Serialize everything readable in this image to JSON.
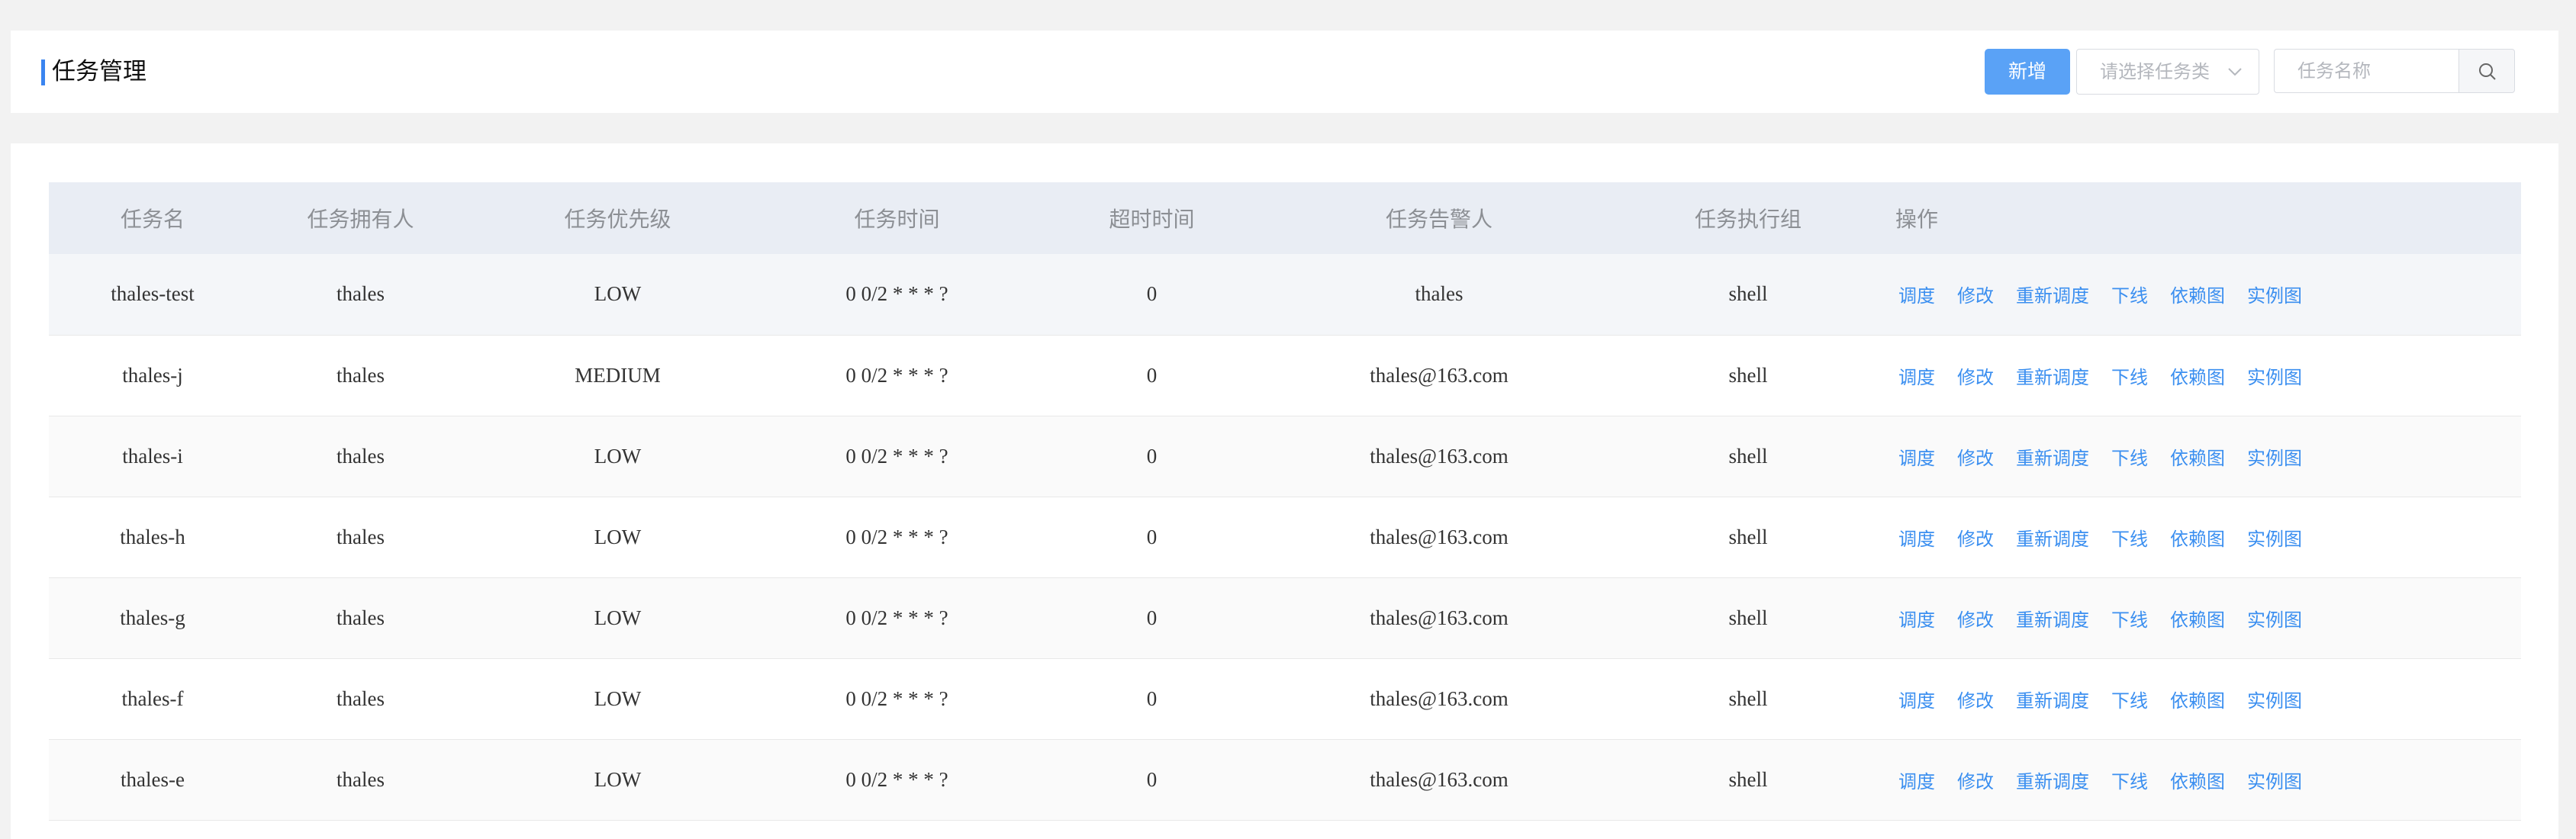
{
  "header": {
    "title": "任务管理",
    "add_label": "新增",
    "type_select_placeholder": "请选择任务类",
    "search_placeholder": "任务名称"
  },
  "table": {
    "columns": [
      "任务名",
      "任务拥有人",
      "任务优先级",
      "任务时间",
      "超时时间",
      "任务告警人",
      "任务执行组",
      "操作"
    ],
    "actions": [
      "调度",
      "修改",
      "重新调度",
      "下线",
      "依赖图",
      "实例图"
    ],
    "rows": [
      {
        "name": "thales-test",
        "owner": "thales",
        "priority": "LOW",
        "time": "0 0/2 * * * ?",
        "timeout": "0",
        "alarm": "thales",
        "group": "shell"
      },
      {
        "name": "thales-j",
        "owner": "thales",
        "priority": "MEDIUM",
        "time": "0 0/2 * * * ?",
        "timeout": "0",
        "alarm": "thales@163.com",
        "group": "shell"
      },
      {
        "name": "thales-i",
        "owner": "thales",
        "priority": "LOW",
        "time": "0 0/2 * * * ?",
        "timeout": "0",
        "alarm": "thales@163.com",
        "group": "shell"
      },
      {
        "name": "thales-h",
        "owner": "thales",
        "priority": "LOW",
        "time": "0 0/2 * * * ?",
        "timeout": "0",
        "alarm": "thales@163.com",
        "group": "shell"
      },
      {
        "name": "thales-g",
        "owner": "thales",
        "priority": "LOW",
        "time": "0 0/2 * * * ?",
        "timeout": "0",
        "alarm": "thales@163.com",
        "group": "shell"
      },
      {
        "name": "thales-f",
        "owner": "thales",
        "priority": "LOW",
        "time": "0 0/2 * * * ?",
        "timeout": "0",
        "alarm": "thales@163.com",
        "group": "shell"
      },
      {
        "name": "thales-e",
        "owner": "thales",
        "priority": "LOW",
        "time": "0 0/2 * * * ?",
        "timeout": "0",
        "alarm": "thales@163.com",
        "group": "shell"
      }
    ]
  },
  "icons": {
    "search": "search-icon",
    "dropdown": "chevron-down-icon"
  },
  "colors": {
    "accent": "#5aa2f6",
    "link": "#3b8ff0",
    "title_bar": "#3a84f0",
    "header_row": "#e9edf4"
  }
}
